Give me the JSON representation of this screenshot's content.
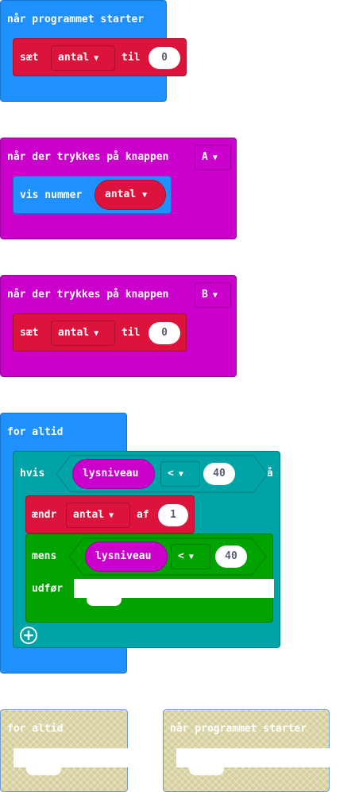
{
  "blocks": {
    "on_start": {
      "label": "når programmet starter",
      "stmt_set": "sæt",
      "var": "antal",
      "to": "til",
      "value": "0"
    },
    "on_button_a": {
      "label": "når der trykkes på knappen",
      "button": "A",
      "stmt": "vis nummer",
      "var": "antal"
    },
    "on_button_b": {
      "label": "når der trykkes på knappen",
      "button": "B",
      "stmt_set": "sæt",
      "var": "antal",
      "to": "til",
      "value": "0"
    },
    "forever": {
      "label": "for altid",
      "if_label": "hvis",
      "then_label": "så",
      "if_sensor": "lysniveau",
      "if_op": "<",
      "if_value": "40",
      "change_label": "ændr",
      "change_var": "antal",
      "change_by": "af",
      "change_value": "1",
      "while_label": "mens",
      "while_sensor": "lysniveau",
      "while_op": "<",
      "while_value": "40",
      "do_label": "udfør"
    },
    "disabled_forever": {
      "label": "for altid"
    },
    "disabled_on_start": {
      "label": "når programmet starter"
    }
  },
  "colors": {
    "basic_blue": "#1e90ff",
    "variables_red": "#dc143c",
    "input_magenta": "#cc00cc",
    "logic_teal": "#00a4a6",
    "loops_green": "#00a300",
    "disabled": "#d4cf9a"
  },
  "icons": {
    "dropdown": "caret-down-icon",
    "add": "plus-circle-icon"
  }
}
